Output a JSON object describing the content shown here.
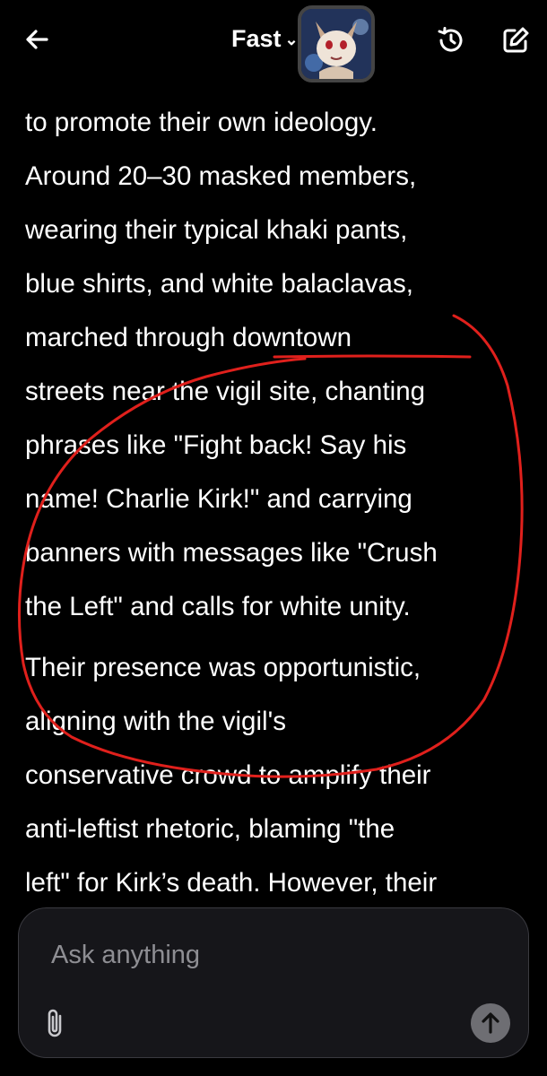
{
  "header": {
    "title": "Fast",
    "chevron": "⌄",
    "icons": {
      "back": "arrow-left-icon",
      "history": "history-icon",
      "edit": "edit-icon",
      "avatar": "avatar"
    }
  },
  "response": {
    "paragraphs": [
      {
        "lines": [
          "to promote their own ideology.",
          "Around 20–30 masked members,",
          "wearing their typical khaki pants,",
          "blue shirts, and white balaclavas,",
          "marched through downtown",
          "streets near the vigil site, chanting",
          "phrases like \"Fight back! Say his",
          "name! Charlie Kirk!\" and carrying",
          "banners with messages like \"Crush",
          "the Left\" and calls for white unity."
        ]
      },
      {
        "lines": [
          "Their presence was opportunistic,",
          "aligning with the vigil's",
          "conservative crowd to amplify their",
          "anti-leftist rhetoric, blaming \"the",
          "left\" for Kirk’s death. However, their"
        ]
      }
    ]
  },
  "annotation": {
    "color": "#e0201c"
  },
  "composer": {
    "placeholder": "Ask anything",
    "attach_icon": "paperclip-icon",
    "send_icon": "arrow-up-icon"
  }
}
